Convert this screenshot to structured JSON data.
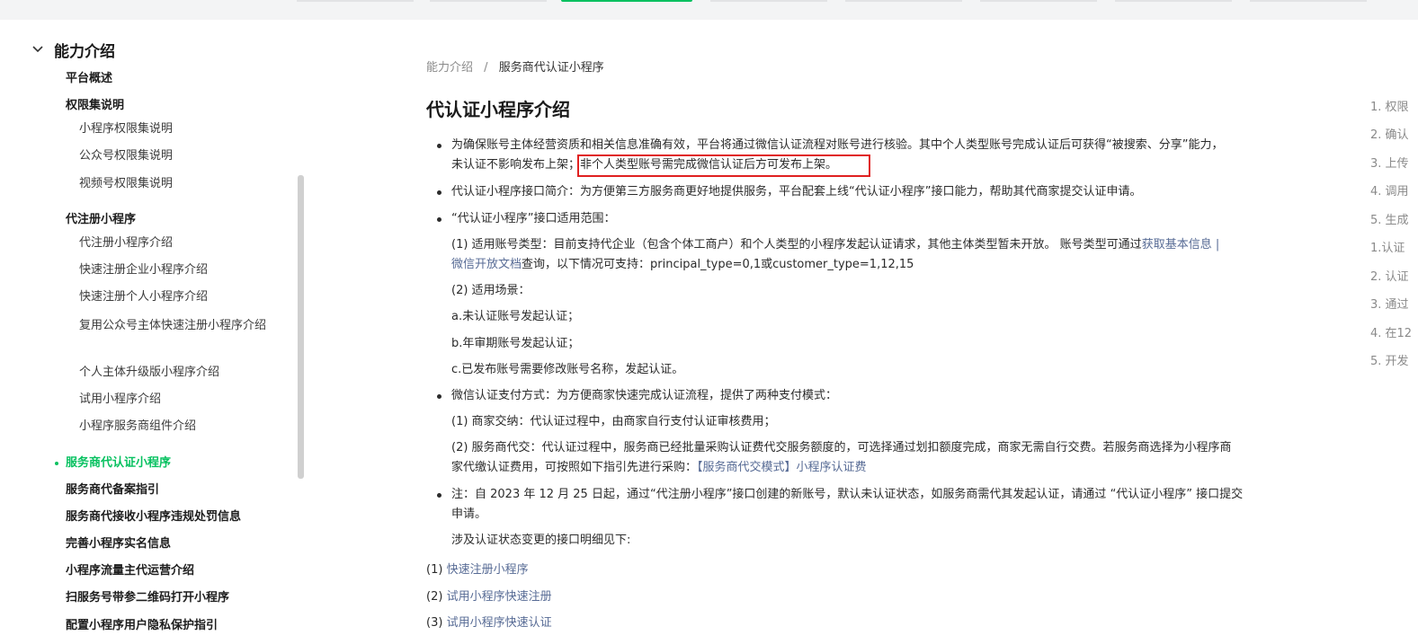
{
  "sidebar": {
    "section_title": "能力介绍",
    "items": [
      {
        "label": "平台概述"
      },
      {
        "label": "权限集说明"
      },
      {
        "label": "小程序权限集说明"
      },
      {
        "label": "公众号权限集说明"
      },
      {
        "label": "视频号权限集说明"
      },
      {
        "label": "代注册小程序"
      },
      {
        "label": "代注册小程序介绍"
      },
      {
        "label": "快速注册企业小程序介绍"
      },
      {
        "label": "快速注册个人小程序介绍"
      },
      {
        "label": "复用公众号主体快速注册小程序介绍"
      },
      {
        "label": "个人主体升级版小程序介绍"
      },
      {
        "label": "试用小程序介绍"
      },
      {
        "label": "小程序服务商组件介绍"
      },
      {
        "label": "服务商代认证小程序"
      },
      {
        "label": "服务商代备案指引"
      },
      {
        "label": "服务商代接收小程序违规处罚信息"
      },
      {
        "label": "完善小程序实名信息"
      },
      {
        "label": "小程序流量主代运营介绍"
      },
      {
        "label": "扫服务号带参二维码打开小程序"
      },
      {
        "label": "配置小程序用户隐私保护指引"
      }
    ]
  },
  "breadcrumb": {
    "parent": "能力介绍",
    "separator": "/",
    "current": "服务商代认证小程序"
  },
  "main": {
    "title": "代认证小程序介绍",
    "p1_line1": "为确保账号主体经营资质和相关信息准确有效，平台将通过微信认证流程对账号进行核验。其中个人类型账号完成认证后可获得“被搜索、分享”能力，",
    "p1_line2a": "未认证不影响发布上架",
    "p1_line2b": "；非个人类型账号需完成微信认证后方可发布上架。",
    "p2": "代认证小程序接口简介：为方便第三方服务商更好地提供服务，平台配套上线“代认证小程序”接口能力，帮助其代商家提交认证申请。",
    "p3": "“代认证小程序”接口适用范围：",
    "p4_line1": "(1) 适用账号类型：目前支持代企业（包含个体工商户）和个人类型的小程序发起认证请求，其他主体类型暂未开放。 账号类型可通过",
    "p4_link1": "获取基本信息 |",
    "p4_link2": "微信开放文档",
    "p4_line2": "查询，以下情况可支持：principal_type=0,1或customer_type=1,12,15",
    "p5": "(2) 适用场景：",
    "p6": "a.未认证账号发起认证；",
    "p7": "b.年审期账号发起认证；",
    "p8": "c.已发布账号需要修改账号名称，发起认证。",
    "p9": "微信认证支付方式：为方便商家快速完成认证流程，提供了两种支付模式：",
    "p10": "(1) 商家交纳：代认证过程中，由商家自行支付认证审核费用；",
    "p11_line1": "(2) 服务商代交：代认证过程中，服务商已经批量采购认证费代交服务额度的，可选择通过划扣额度完成，商家无需自行交费。若服务商选择为小程序商",
    "p11_line2": "家代缴认证费用，可按照如下指引先进行采购：",
    "p11_link": "【服务商代交模式】小程序认证费",
    "p12_line1": "注：自 2023 年 12 月 25 日起，通过“代注册小程序”接口创建的新账号，默认未认证状态，如服务商需代其发起认证，请通过 “代认证小程序” 接口提交",
    "p12_line2": "申请。",
    "p13": "涉及认证状态变更的接口明细见下:",
    "list": [
      {
        "num": "(1)",
        "text": "快速注册小程序"
      },
      {
        "num": "(2)",
        "text": "试用小程序快速注册"
      },
      {
        "num": "(3)",
        "text": "试用小程序快速认证"
      }
    ]
  },
  "toc": [
    "1. 权限",
    "2. 确认",
    "3. 上传",
    "4. 调用",
    "5. 生成",
    "1.认证",
    "2. 认证",
    "3. 通过",
    "4. 在12",
    "5. 开发"
  ],
  "colors": {
    "accent": "#07c160",
    "link": "#576b95",
    "highlight": "#e02020"
  }
}
